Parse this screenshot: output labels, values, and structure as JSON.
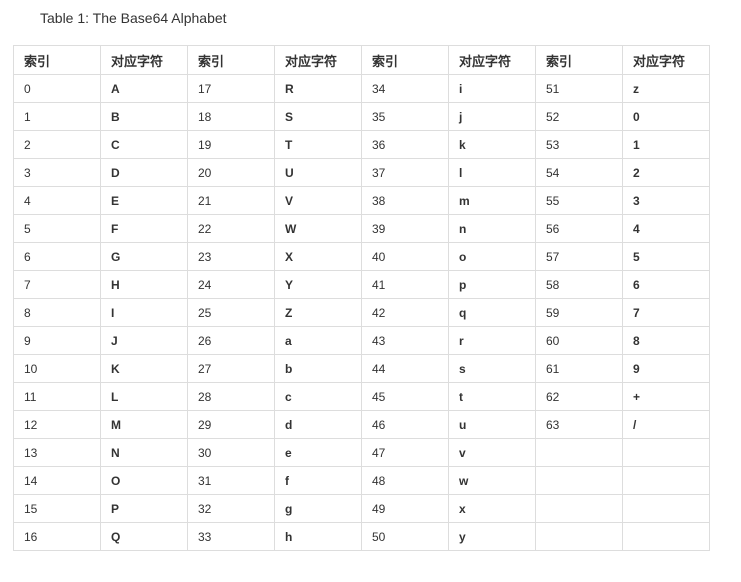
{
  "caption": "Table 1: The Base64 Alphabet",
  "header": [
    "索引",
    "对应字符",
    "索引",
    "对应字符",
    "索引",
    "对应字符",
    "索引",
    "对应字符"
  ],
  "rows": [
    [
      "0",
      "A",
      "17",
      "R",
      "34",
      "i",
      "51",
      "z"
    ],
    [
      "1",
      "B",
      "18",
      "S",
      "35",
      "j",
      "52",
      "0"
    ],
    [
      "2",
      "C",
      "19",
      "T",
      "36",
      "k",
      "53",
      "1"
    ],
    [
      "3",
      "D",
      "20",
      "U",
      "37",
      "l",
      "54",
      "2"
    ],
    [
      "4",
      "E",
      "21",
      "V",
      "38",
      "m",
      "55",
      "3"
    ],
    [
      "5",
      "F",
      "22",
      "W",
      "39",
      "n",
      "56",
      "4"
    ],
    [
      "6",
      "G",
      "23",
      "X",
      "40",
      "o",
      "57",
      "5"
    ],
    [
      "7",
      "H",
      "24",
      "Y",
      "41",
      "p",
      "58",
      "6"
    ],
    [
      "8",
      "I",
      "25",
      "Z",
      "42",
      "q",
      "59",
      "7"
    ],
    [
      "9",
      "J",
      "26",
      "a",
      "43",
      "r",
      "60",
      "8"
    ],
    [
      "10",
      "K",
      "27",
      "b",
      "44",
      "s",
      "61",
      "9"
    ],
    [
      "11",
      "L",
      "28",
      "c",
      "45",
      "t",
      "62",
      "+"
    ],
    [
      "12",
      "M",
      "29",
      "d",
      "46",
      "u",
      "63",
      "/"
    ],
    [
      "13",
      "N",
      "30",
      "e",
      "47",
      "v",
      "",
      ""
    ],
    [
      "14",
      "O",
      "31",
      "f",
      "48",
      "w",
      "",
      ""
    ],
    [
      "15",
      "P",
      "32",
      "g",
      "49",
      "x",
      "",
      ""
    ],
    [
      "16",
      "Q",
      "33",
      "h",
      "50",
      "y",
      "",
      ""
    ]
  ]
}
